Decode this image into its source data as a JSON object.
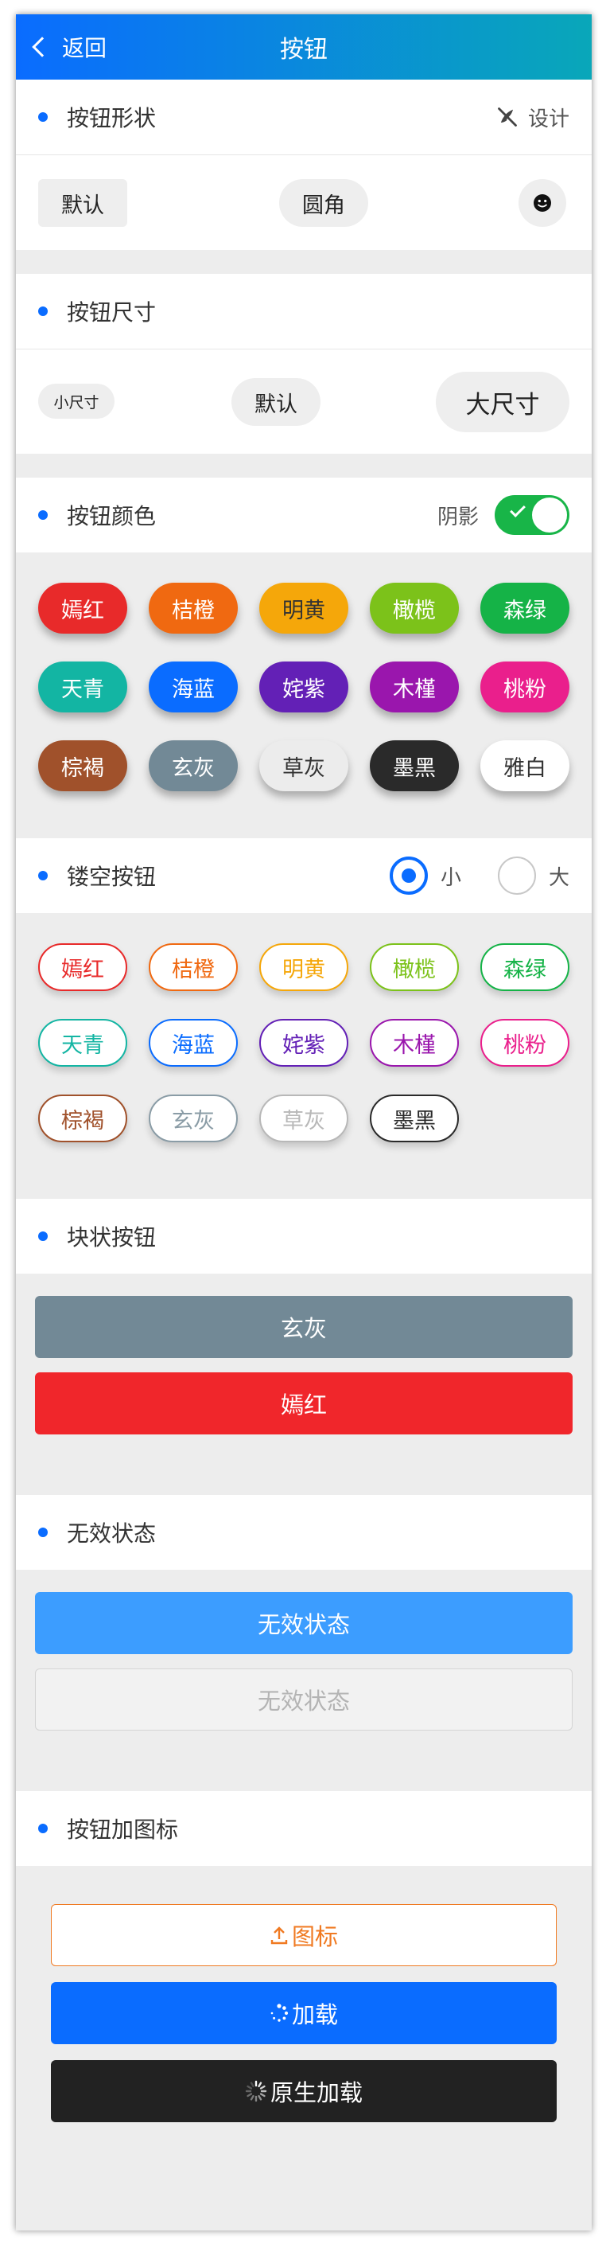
{
  "nav": {
    "back_label": "返回",
    "title": "按钮"
  },
  "shape": {
    "title": "按钮形状",
    "design_label": "设计",
    "default_label": "默认",
    "round_label": "圆角",
    "icon_button": "smiley-icon"
  },
  "size": {
    "title": "按钮尺寸",
    "small_label": "小尺寸",
    "default_label": "默认",
    "large_label": "大尺寸"
  },
  "colors": {
    "title": "按钮颜色",
    "shadow_label": "阴影",
    "shadow_enabled": true,
    "buttons": [
      {
        "label": "嫣红",
        "color": "#e82a2a",
        "text": "#ffffff"
      },
      {
        "label": "桔橙",
        "color": "#f06911",
        "text": "#ffffff"
      },
      {
        "label": "明黄",
        "color": "#f5a70a",
        "text": "#333333"
      },
      {
        "label": "橄榄",
        "color": "#7cc21a",
        "text": "#ffffff"
      },
      {
        "label": "森绿",
        "color": "#15b347",
        "text": "#ffffff"
      },
      {
        "label": "天青",
        "color": "#13b5a3",
        "text": "#ffffff"
      },
      {
        "label": "海蓝",
        "color": "#0a6cff",
        "text": "#ffffff"
      },
      {
        "label": "姹紫",
        "color": "#6320b6",
        "text": "#ffffff"
      },
      {
        "label": "木槿",
        "color": "#9a16ad",
        "text": "#ffffff"
      },
      {
        "label": "桃粉",
        "color": "#ea1f8c",
        "text": "#ffffff"
      },
      {
        "label": "棕褐",
        "color": "#a0512b",
        "text": "#ffffff"
      },
      {
        "label": "玄灰",
        "color": "#728996",
        "text": "#ffffff"
      },
      {
        "label": "草灰",
        "color": "#ececec",
        "text": "#333333"
      },
      {
        "label": "墨黑",
        "color": "#2a2a2a",
        "text": "#ffffff"
      },
      {
        "label": "雅白",
        "color": "#ffffff",
        "text": "#333333"
      }
    ]
  },
  "outline": {
    "title": "镂空按钮",
    "small_label": "小",
    "large_label": "大",
    "selected": "小",
    "buttons": [
      {
        "label": "嫣红",
        "color": "#e82a2a"
      },
      {
        "label": "桔橙",
        "color": "#f06911"
      },
      {
        "label": "明黄",
        "color": "#f5a70a"
      },
      {
        "label": "橄榄",
        "color": "#7cc21a"
      },
      {
        "label": "森绿",
        "color": "#15b347"
      },
      {
        "label": "天青",
        "color": "#13b5a3"
      },
      {
        "label": "海蓝",
        "color": "#0a6cff"
      },
      {
        "label": "姹紫",
        "color": "#6320b6"
      },
      {
        "label": "木槿",
        "color": "#9a16ad"
      },
      {
        "label": "桃粉",
        "color": "#ea1f8c"
      },
      {
        "label": "棕褐",
        "color": "#a0512b"
      },
      {
        "label": "玄灰",
        "color": "#8a9ca6"
      },
      {
        "label": "草灰",
        "color": "#b8b8b8"
      },
      {
        "label": "墨黑",
        "color": "#2a2a2a"
      }
    ]
  },
  "block": {
    "title": "块状按钮",
    "btn1_label": "玄灰",
    "btn1_color": "#728996",
    "btn2_label": "嫣红",
    "btn2_color": "#f0262b"
  },
  "disabled": {
    "title": "无效状态",
    "btn1_label": "无效状态",
    "btn1_color": "#3c9dff",
    "btn2_label": "无效状态"
  },
  "icons": {
    "title": "按钮加图标",
    "upload_label": "图标",
    "upload_color": "#f07a22",
    "loading_label": "加载",
    "loading_color": "#0a6cff",
    "native_label": "原生加载",
    "native_color": "#222222"
  }
}
